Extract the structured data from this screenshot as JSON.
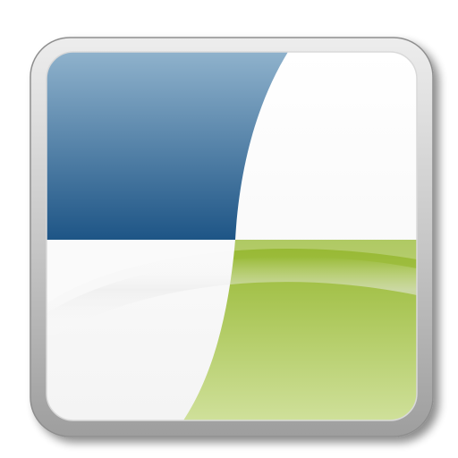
{
  "icon": {
    "name": "app-icon",
    "colors": {
      "blue_top": "#8FB2CC",
      "blue_bottom": "#1E5586",
      "green_top": "#95B72F",
      "green_bottom": "#CFE09A",
      "frame_light": "#E6E6E6",
      "frame_dark": "#9A9A9A",
      "white": "#FFFFFF"
    }
  }
}
